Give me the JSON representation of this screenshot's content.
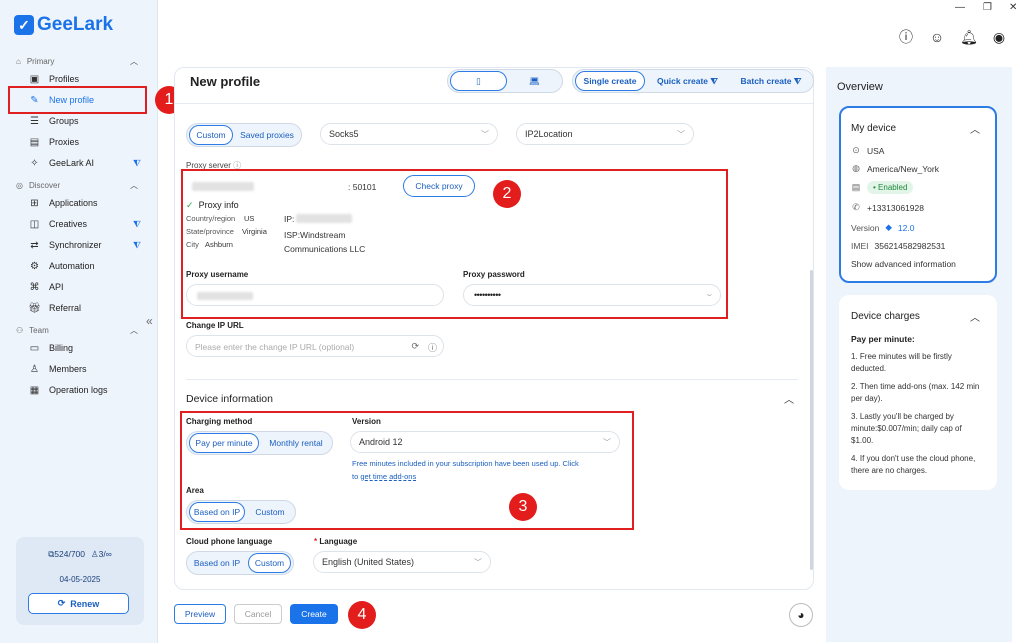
{
  "app": {
    "name": "GeeLark"
  },
  "sidebar": {
    "section_primary": "Primary",
    "section_discover": "Discover",
    "section_team": "Team",
    "items": [
      {
        "label": "Profiles",
        "icon": "profiles-icon"
      },
      {
        "label": "New profile",
        "icon": "edit-icon"
      },
      {
        "label": "Groups",
        "icon": "list-icon"
      },
      {
        "label": "Proxies",
        "icon": "proxy-icon"
      },
      {
        "label": "GeeLark AI",
        "icon": "ai-icon"
      },
      {
        "label": "Applications",
        "icon": "apps-icon"
      },
      {
        "label": "Creatives",
        "icon": "creatives-icon"
      },
      {
        "label": "Synchronizer",
        "icon": "sync-icon"
      },
      {
        "label": "Automation",
        "icon": "automation-icon"
      },
      {
        "label": "API",
        "icon": "api-icon"
      },
      {
        "label": "Referral",
        "icon": "gift-icon"
      },
      {
        "label": "Billing",
        "icon": "billing-icon"
      },
      {
        "label": "Members",
        "icon": "members-icon"
      },
      {
        "label": "Operation logs",
        "icon": "logs-icon"
      }
    ],
    "plan": {
      "profiles": "524/700",
      "members": "3/∞",
      "date": "04-05-2025",
      "renew": "Renew"
    }
  },
  "header": {
    "title": "New profile"
  },
  "create_modes": {
    "single": "Single create",
    "quick": "Quick create",
    "batch": "Batch create"
  },
  "proxy": {
    "type_custom": "Custom",
    "type_saved": "Saved proxies",
    "protocol": "Socks5",
    "ip_checker": "IP2Location",
    "server_label": "Proxy server",
    "port": ": 50101",
    "check_button": "Check proxy",
    "info_title": "Proxy info",
    "country_label": "Country/region",
    "country": "US",
    "state_label": "State/province",
    "state": "Virginia",
    "city_label": "City",
    "city": "Ashburn",
    "ip_label": "IP:",
    "isp": "ISP:Windstream",
    "isp2": "Communications LLC",
    "username_label": "Proxy username",
    "password_label": "Proxy password",
    "password_value": "••••••••••",
    "change_ip_label": "Change IP URL",
    "change_ip_placeholder": "Please enter the change IP URL (optional)"
  },
  "device": {
    "section_title": "Device information",
    "charging_label": "Charging method",
    "pay_per_minute": "Pay per minute",
    "monthly_rental": "Monthly rental",
    "version_label": "Version",
    "version_value": "Android 12",
    "free_note": "Free minutes included in your subscription have been used up. Click",
    "free_note2": "to",
    "free_link": "get time add-ons",
    "area_label": "Area",
    "area_based_ip": "Based on IP",
    "area_custom": "Custom",
    "lang_label": "Cloud phone language",
    "lang_based_ip": "Based on IP",
    "lang_custom": "Custom",
    "language_label": "Language",
    "language_req": "*",
    "language_value": "English (United States)"
  },
  "footer": {
    "preview": "Preview",
    "cancel": "Cancel",
    "create": "Create"
  },
  "overview": {
    "title": "Overview",
    "my_device": "My device",
    "country": "USA",
    "timezone": "America/New_York",
    "status": "Enabled",
    "phone": "+13313061928",
    "version_label": "Version",
    "version": "12.0",
    "imei_label": "IMEI",
    "imei": "356214582982531",
    "show_advanced": "Show advanced information",
    "charges_title": "Device charges",
    "charges_sub": "Pay per minute:",
    "charges_1": "1. Free minutes will be firstly deducted.",
    "charges_2": "2. Then time add-ons (max. 142 min per day).",
    "charges_3": "3. Lastly you'll be charged by minute:$0.007/min; daily cap of $1.00.",
    "charges_4": "4. If you don't use the cloud phone, there are no charges."
  },
  "annotations": [
    "1",
    "2",
    "3",
    "4"
  ],
  "colors": {
    "accent": "#1a73e8",
    "annotation": "#e31c1c",
    "sidebar_bg": "#eef4fc"
  }
}
